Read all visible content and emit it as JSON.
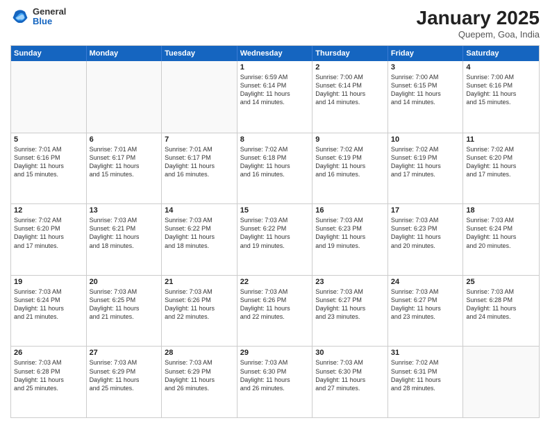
{
  "header": {
    "logo": {
      "general": "General",
      "blue": "Blue"
    },
    "title": "January 2025",
    "location": "Quepem, Goa, India"
  },
  "weekdays": [
    "Sunday",
    "Monday",
    "Tuesday",
    "Wednesday",
    "Thursday",
    "Friday",
    "Saturday"
  ],
  "rows": [
    [
      {
        "day": "",
        "lines": []
      },
      {
        "day": "",
        "lines": []
      },
      {
        "day": "",
        "lines": []
      },
      {
        "day": "1",
        "lines": [
          "Sunrise: 6:59 AM",
          "Sunset: 6:14 PM",
          "Daylight: 11 hours",
          "and 14 minutes."
        ]
      },
      {
        "day": "2",
        "lines": [
          "Sunrise: 7:00 AM",
          "Sunset: 6:14 PM",
          "Daylight: 11 hours",
          "and 14 minutes."
        ]
      },
      {
        "day": "3",
        "lines": [
          "Sunrise: 7:00 AM",
          "Sunset: 6:15 PM",
          "Daylight: 11 hours",
          "and 14 minutes."
        ]
      },
      {
        "day": "4",
        "lines": [
          "Sunrise: 7:00 AM",
          "Sunset: 6:16 PM",
          "Daylight: 11 hours",
          "and 15 minutes."
        ]
      }
    ],
    [
      {
        "day": "5",
        "lines": [
          "Sunrise: 7:01 AM",
          "Sunset: 6:16 PM",
          "Daylight: 11 hours",
          "and 15 minutes."
        ]
      },
      {
        "day": "6",
        "lines": [
          "Sunrise: 7:01 AM",
          "Sunset: 6:17 PM",
          "Daylight: 11 hours",
          "and 15 minutes."
        ]
      },
      {
        "day": "7",
        "lines": [
          "Sunrise: 7:01 AM",
          "Sunset: 6:17 PM",
          "Daylight: 11 hours",
          "and 16 minutes."
        ]
      },
      {
        "day": "8",
        "lines": [
          "Sunrise: 7:02 AM",
          "Sunset: 6:18 PM",
          "Daylight: 11 hours",
          "and 16 minutes."
        ]
      },
      {
        "day": "9",
        "lines": [
          "Sunrise: 7:02 AM",
          "Sunset: 6:19 PM",
          "Daylight: 11 hours",
          "and 16 minutes."
        ]
      },
      {
        "day": "10",
        "lines": [
          "Sunrise: 7:02 AM",
          "Sunset: 6:19 PM",
          "Daylight: 11 hours",
          "and 17 minutes."
        ]
      },
      {
        "day": "11",
        "lines": [
          "Sunrise: 7:02 AM",
          "Sunset: 6:20 PM",
          "Daylight: 11 hours",
          "and 17 minutes."
        ]
      }
    ],
    [
      {
        "day": "12",
        "lines": [
          "Sunrise: 7:02 AM",
          "Sunset: 6:20 PM",
          "Daylight: 11 hours",
          "and 17 minutes."
        ]
      },
      {
        "day": "13",
        "lines": [
          "Sunrise: 7:03 AM",
          "Sunset: 6:21 PM",
          "Daylight: 11 hours",
          "and 18 minutes."
        ]
      },
      {
        "day": "14",
        "lines": [
          "Sunrise: 7:03 AM",
          "Sunset: 6:22 PM",
          "Daylight: 11 hours",
          "and 18 minutes."
        ]
      },
      {
        "day": "15",
        "lines": [
          "Sunrise: 7:03 AM",
          "Sunset: 6:22 PM",
          "Daylight: 11 hours",
          "and 19 minutes."
        ]
      },
      {
        "day": "16",
        "lines": [
          "Sunrise: 7:03 AM",
          "Sunset: 6:23 PM",
          "Daylight: 11 hours",
          "and 19 minutes."
        ]
      },
      {
        "day": "17",
        "lines": [
          "Sunrise: 7:03 AM",
          "Sunset: 6:23 PM",
          "Daylight: 11 hours",
          "and 20 minutes."
        ]
      },
      {
        "day": "18",
        "lines": [
          "Sunrise: 7:03 AM",
          "Sunset: 6:24 PM",
          "Daylight: 11 hours",
          "and 20 minutes."
        ]
      }
    ],
    [
      {
        "day": "19",
        "lines": [
          "Sunrise: 7:03 AM",
          "Sunset: 6:24 PM",
          "Daylight: 11 hours",
          "and 21 minutes."
        ]
      },
      {
        "day": "20",
        "lines": [
          "Sunrise: 7:03 AM",
          "Sunset: 6:25 PM",
          "Daylight: 11 hours",
          "and 21 minutes."
        ]
      },
      {
        "day": "21",
        "lines": [
          "Sunrise: 7:03 AM",
          "Sunset: 6:26 PM",
          "Daylight: 11 hours",
          "and 22 minutes."
        ]
      },
      {
        "day": "22",
        "lines": [
          "Sunrise: 7:03 AM",
          "Sunset: 6:26 PM",
          "Daylight: 11 hours",
          "and 22 minutes."
        ]
      },
      {
        "day": "23",
        "lines": [
          "Sunrise: 7:03 AM",
          "Sunset: 6:27 PM",
          "Daylight: 11 hours",
          "and 23 minutes."
        ]
      },
      {
        "day": "24",
        "lines": [
          "Sunrise: 7:03 AM",
          "Sunset: 6:27 PM",
          "Daylight: 11 hours",
          "and 23 minutes."
        ]
      },
      {
        "day": "25",
        "lines": [
          "Sunrise: 7:03 AM",
          "Sunset: 6:28 PM",
          "Daylight: 11 hours",
          "and 24 minutes."
        ]
      }
    ],
    [
      {
        "day": "26",
        "lines": [
          "Sunrise: 7:03 AM",
          "Sunset: 6:28 PM",
          "Daylight: 11 hours",
          "and 25 minutes."
        ]
      },
      {
        "day": "27",
        "lines": [
          "Sunrise: 7:03 AM",
          "Sunset: 6:29 PM",
          "Daylight: 11 hours",
          "and 25 minutes."
        ]
      },
      {
        "day": "28",
        "lines": [
          "Sunrise: 7:03 AM",
          "Sunset: 6:29 PM",
          "Daylight: 11 hours",
          "and 26 minutes."
        ]
      },
      {
        "day": "29",
        "lines": [
          "Sunrise: 7:03 AM",
          "Sunset: 6:30 PM",
          "Daylight: 11 hours",
          "and 26 minutes."
        ]
      },
      {
        "day": "30",
        "lines": [
          "Sunrise: 7:03 AM",
          "Sunset: 6:30 PM",
          "Daylight: 11 hours",
          "and 27 minutes."
        ]
      },
      {
        "day": "31",
        "lines": [
          "Sunrise: 7:02 AM",
          "Sunset: 6:31 PM",
          "Daylight: 11 hours",
          "and 28 minutes."
        ]
      },
      {
        "day": "",
        "lines": []
      }
    ]
  ]
}
